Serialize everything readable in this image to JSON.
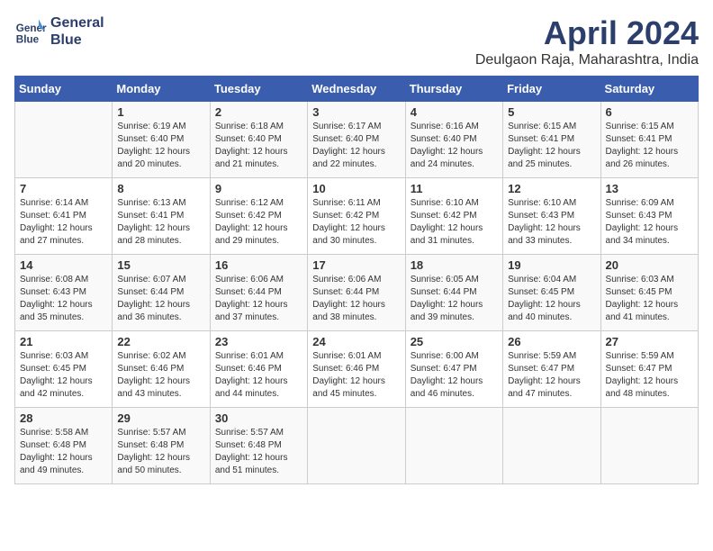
{
  "header": {
    "logo_line1": "General",
    "logo_line2": "Blue",
    "month": "April 2024",
    "location": "Deulgaon Raja, Maharashtra, India"
  },
  "weekdays": [
    "Sunday",
    "Monday",
    "Tuesday",
    "Wednesday",
    "Thursday",
    "Friday",
    "Saturday"
  ],
  "weeks": [
    [
      {
        "day": "",
        "sunrise": "",
        "sunset": "",
        "daylight": ""
      },
      {
        "day": "1",
        "sunrise": "Sunrise: 6:19 AM",
        "sunset": "Sunset: 6:40 PM",
        "daylight": "Daylight: 12 hours and 20 minutes."
      },
      {
        "day": "2",
        "sunrise": "Sunrise: 6:18 AM",
        "sunset": "Sunset: 6:40 PM",
        "daylight": "Daylight: 12 hours and 21 minutes."
      },
      {
        "day": "3",
        "sunrise": "Sunrise: 6:17 AM",
        "sunset": "Sunset: 6:40 PM",
        "daylight": "Daylight: 12 hours and 22 minutes."
      },
      {
        "day": "4",
        "sunrise": "Sunrise: 6:16 AM",
        "sunset": "Sunset: 6:40 PM",
        "daylight": "Daylight: 12 hours and 24 minutes."
      },
      {
        "day": "5",
        "sunrise": "Sunrise: 6:15 AM",
        "sunset": "Sunset: 6:41 PM",
        "daylight": "Daylight: 12 hours and 25 minutes."
      },
      {
        "day": "6",
        "sunrise": "Sunrise: 6:15 AM",
        "sunset": "Sunset: 6:41 PM",
        "daylight": "Daylight: 12 hours and 26 minutes."
      }
    ],
    [
      {
        "day": "7",
        "sunrise": "Sunrise: 6:14 AM",
        "sunset": "Sunset: 6:41 PM",
        "daylight": "Daylight: 12 hours and 27 minutes."
      },
      {
        "day": "8",
        "sunrise": "Sunrise: 6:13 AM",
        "sunset": "Sunset: 6:41 PM",
        "daylight": "Daylight: 12 hours and 28 minutes."
      },
      {
        "day": "9",
        "sunrise": "Sunrise: 6:12 AM",
        "sunset": "Sunset: 6:42 PM",
        "daylight": "Daylight: 12 hours and 29 minutes."
      },
      {
        "day": "10",
        "sunrise": "Sunrise: 6:11 AM",
        "sunset": "Sunset: 6:42 PM",
        "daylight": "Daylight: 12 hours and 30 minutes."
      },
      {
        "day": "11",
        "sunrise": "Sunrise: 6:10 AM",
        "sunset": "Sunset: 6:42 PM",
        "daylight": "Daylight: 12 hours and 31 minutes."
      },
      {
        "day": "12",
        "sunrise": "Sunrise: 6:10 AM",
        "sunset": "Sunset: 6:43 PM",
        "daylight": "Daylight: 12 hours and 33 minutes."
      },
      {
        "day": "13",
        "sunrise": "Sunrise: 6:09 AM",
        "sunset": "Sunset: 6:43 PM",
        "daylight": "Daylight: 12 hours and 34 minutes."
      }
    ],
    [
      {
        "day": "14",
        "sunrise": "Sunrise: 6:08 AM",
        "sunset": "Sunset: 6:43 PM",
        "daylight": "Daylight: 12 hours and 35 minutes."
      },
      {
        "day": "15",
        "sunrise": "Sunrise: 6:07 AM",
        "sunset": "Sunset: 6:44 PM",
        "daylight": "Daylight: 12 hours and 36 minutes."
      },
      {
        "day": "16",
        "sunrise": "Sunrise: 6:06 AM",
        "sunset": "Sunset: 6:44 PM",
        "daylight": "Daylight: 12 hours and 37 minutes."
      },
      {
        "day": "17",
        "sunrise": "Sunrise: 6:06 AM",
        "sunset": "Sunset: 6:44 PM",
        "daylight": "Daylight: 12 hours and 38 minutes."
      },
      {
        "day": "18",
        "sunrise": "Sunrise: 6:05 AM",
        "sunset": "Sunset: 6:44 PM",
        "daylight": "Daylight: 12 hours and 39 minutes."
      },
      {
        "day": "19",
        "sunrise": "Sunrise: 6:04 AM",
        "sunset": "Sunset: 6:45 PM",
        "daylight": "Daylight: 12 hours and 40 minutes."
      },
      {
        "day": "20",
        "sunrise": "Sunrise: 6:03 AM",
        "sunset": "Sunset: 6:45 PM",
        "daylight": "Daylight: 12 hours and 41 minutes."
      }
    ],
    [
      {
        "day": "21",
        "sunrise": "Sunrise: 6:03 AM",
        "sunset": "Sunset: 6:45 PM",
        "daylight": "Daylight: 12 hours and 42 minutes."
      },
      {
        "day": "22",
        "sunrise": "Sunrise: 6:02 AM",
        "sunset": "Sunset: 6:46 PM",
        "daylight": "Daylight: 12 hours and 43 minutes."
      },
      {
        "day": "23",
        "sunrise": "Sunrise: 6:01 AM",
        "sunset": "Sunset: 6:46 PM",
        "daylight": "Daylight: 12 hours and 44 minutes."
      },
      {
        "day": "24",
        "sunrise": "Sunrise: 6:01 AM",
        "sunset": "Sunset: 6:46 PM",
        "daylight": "Daylight: 12 hours and 45 minutes."
      },
      {
        "day": "25",
        "sunrise": "Sunrise: 6:00 AM",
        "sunset": "Sunset: 6:47 PM",
        "daylight": "Daylight: 12 hours and 46 minutes."
      },
      {
        "day": "26",
        "sunrise": "Sunrise: 5:59 AM",
        "sunset": "Sunset: 6:47 PM",
        "daylight": "Daylight: 12 hours and 47 minutes."
      },
      {
        "day": "27",
        "sunrise": "Sunrise: 5:59 AM",
        "sunset": "Sunset: 6:47 PM",
        "daylight": "Daylight: 12 hours and 48 minutes."
      }
    ],
    [
      {
        "day": "28",
        "sunrise": "Sunrise: 5:58 AM",
        "sunset": "Sunset: 6:48 PM",
        "daylight": "Daylight: 12 hours and 49 minutes."
      },
      {
        "day": "29",
        "sunrise": "Sunrise: 5:57 AM",
        "sunset": "Sunset: 6:48 PM",
        "daylight": "Daylight: 12 hours and 50 minutes."
      },
      {
        "day": "30",
        "sunrise": "Sunrise: 5:57 AM",
        "sunset": "Sunset: 6:48 PM",
        "daylight": "Daylight: 12 hours and 51 minutes."
      },
      {
        "day": "",
        "sunrise": "",
        "sunset": "",
        "daylight": ""
      },
      {
        "day": "",
        "sunrise": "",
        "sunset": "",
        "daylight": ""
      },
      {
        "day": "",
        "sunrise": "",
        "sunset": "",
        "daylight": ""
      },
      {
        "day": "",
        "sunrise": "",
        "sunset": "",
        "daylight": ""
      }
    ]
  ]
}
